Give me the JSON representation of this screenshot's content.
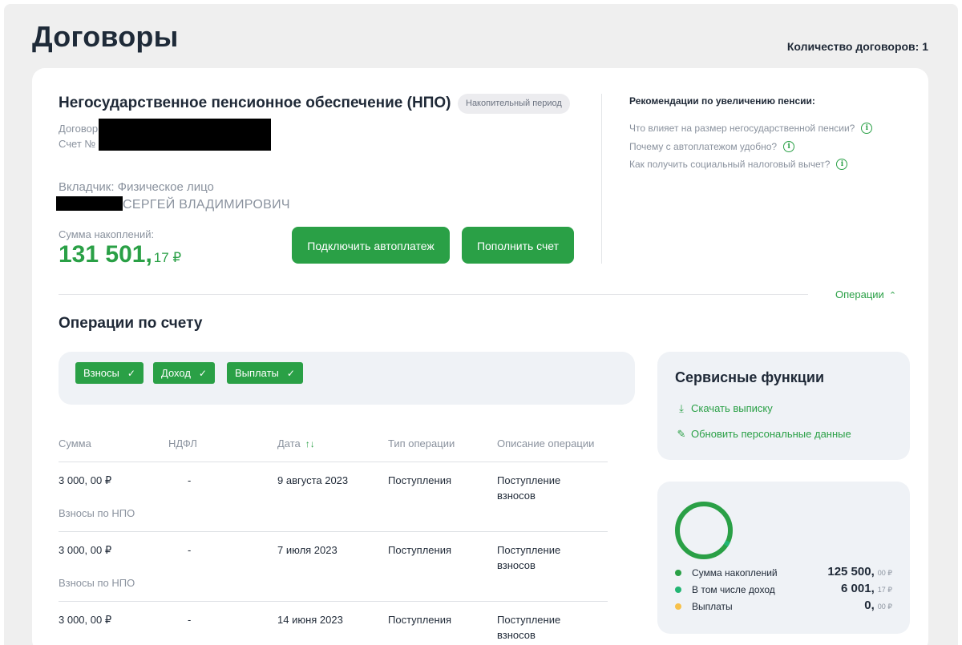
{
  "page": {
    "title": "Договоры",
    "contracts_count": "Количество договоров: 1"
  },
  "contract": {
    "title": "Негосударственное пенсионное обеспечение (НПО)",
    "period_badge": "Накопительный период",
    "contract_label": "Договор",
    "account_label": "Счет №",
    "depositor": "Вкладчик: Физическое лицо",
    "depositor_name": "СЕРГЕЙ ВЛАДИМИРОВИЧ",
    "sum_label": "Сумма накоплений:",
    "sum_main": "131 501,",
    "sum_kopecks": "17 ₽",
    "autopay_button": "Подключить автоплатеж",
    "topup_button": "Пополнить счет"
  },
  "recommendations": {
    "title": "Рекомендации по увеличению пенсии:",
    "links": [
      "Что влияет на размер негосударственной пенсии?",
      "Почему с автоплатежом удобно?",
      "Как получить социальный налоговый вычет?"
    ]
  },
  "operations": {
    "toggle_label": "Операции",
    "title": "Операции по счету",
    "filters": [
      "Взносы",
      "Доход",
      "Выплаты"
    ],
    "columns": [
      "Сумма",
      "НДФЛ",
      "Дата",
      "Тип операции",
      "Описание операции"
    ],
    "rows": [
      {
        "amount": "3 000, 00 ₽",
        "ndfl": "-",
        "date": "9 августа 2023",
        "type": "Поступления",
        "desc": "Поступление взносов",
        "sub": "Взносы по НПО"
      },
      {
        "amount": "3 000, 00 ₽",
        "ndfl": "-",
        "date": "7 июля 2023",
        "type": "Поступления",
        "desc": "Поступление взносов",
        "sub": "Взносы по НПО"
      },
      {
        "amount": "3 000, 00 ₽",
        "ndfl": "-",
        "date": "14 июня 2023",
        "type": "Поступления",
        "desc": "Поступление взносов",
        "sub": ""
      }
    ]
  },
  "service": {
    "title": "Сервисные функции",
    "download_statement": "Скачать выписку",
    "update_personal": "Обновить персональные данные"
  },
  "stats": {
    "colors": {
      "accumulation": "#2aa046",
      "income": "#22b573",
      "payouts": "#f7c14b"
    },
    "items": [
      {
        "label": "Сумма накоплений",
        "main": "125 500,",
        "kop": "00 ₽"
      },
      {
        "label": "В том числе доход",
        "main": "6 001,",
        "kop": "17 ₽"
      },
      {
        "label": "Выплаты",
        "main": "0,",
        "kop": "00 ₽"
      }
    ]
  },
  "icons": {
    "sort": "sort-arrows-icon",
    "check": "checkmark-icon",
    "info": "info-icon",
    "download": "download-icon",
    "edit": "pencil-icon",
    "chevron": "chevron-up-icon"
  }
}
